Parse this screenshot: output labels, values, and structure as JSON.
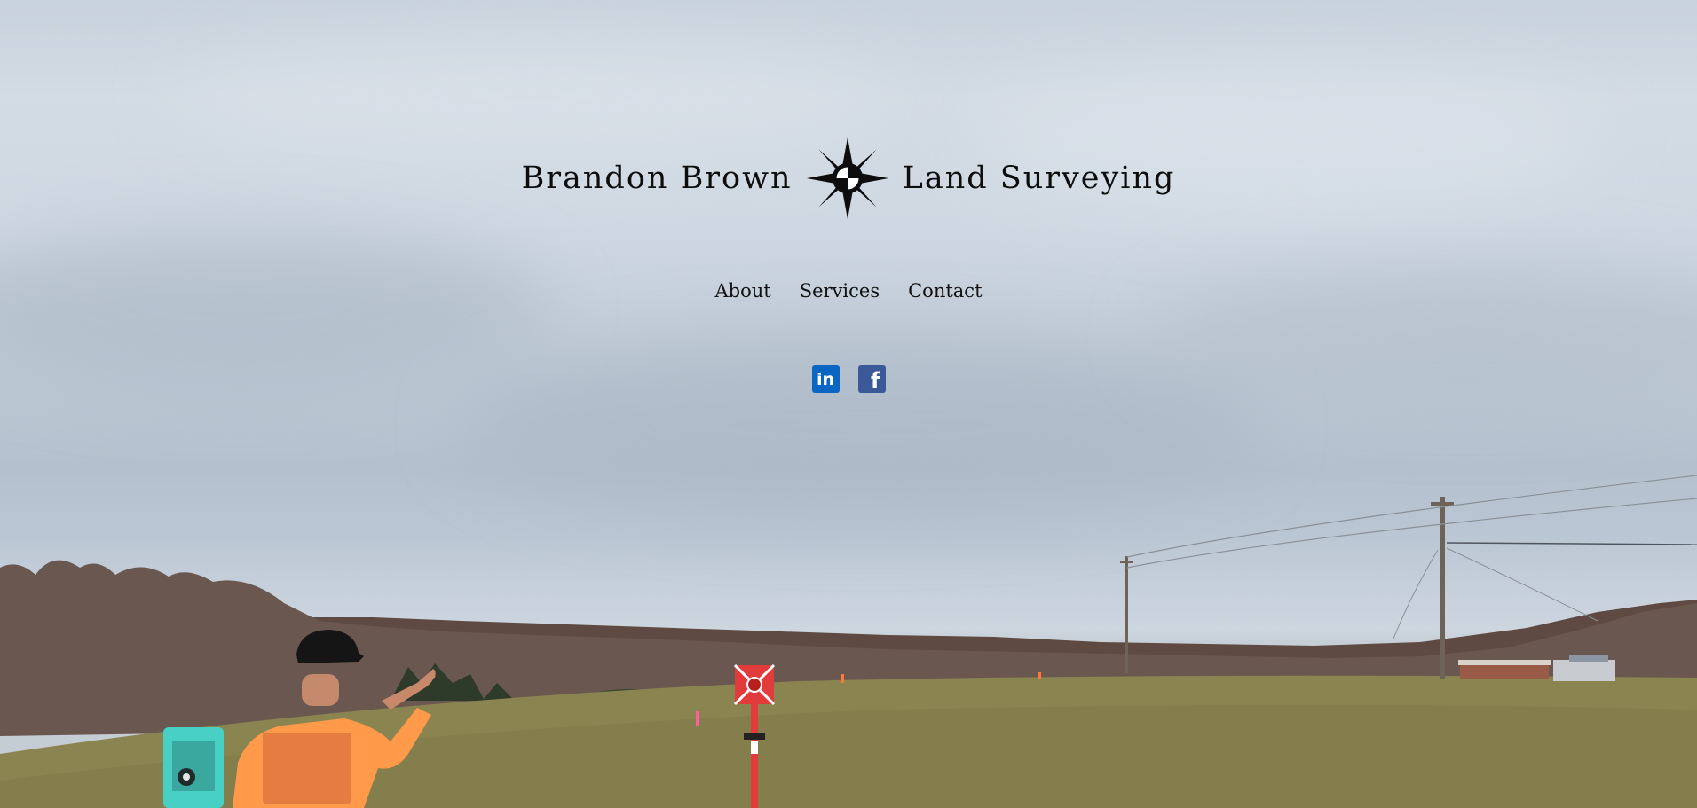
{
  "brand": {
    "name_left": "Brandon Brown",
    "name_right": "Land Surveying",
    "logo_icon": "compass-star-icon"
  },
  "nav": {
    "items": [
      {
        "label": "About"
      },
      {
        "label": "Services"
      },
      {
        "label": "Contact"
      }
    ]
  },
  "social": {
    "linkedin": {
      "glyph": "in",
      "icon": "linkedin-icon",
      "color": "#0a66c2"
    },
    "facebook": {
      "glyph": "f",
      "icon": "facebook-icon",
      "color": "#3b5998"
    }
  },
  "colors": {
    "text": "#0d0d0d",
    "sky": "#c9d3dd",
    "grass": "#8a8450",
    "shirt": "#ff9a4a",
    "tripod": "#49d0c4",
    "prism": "#e23b3b"
  }
}
